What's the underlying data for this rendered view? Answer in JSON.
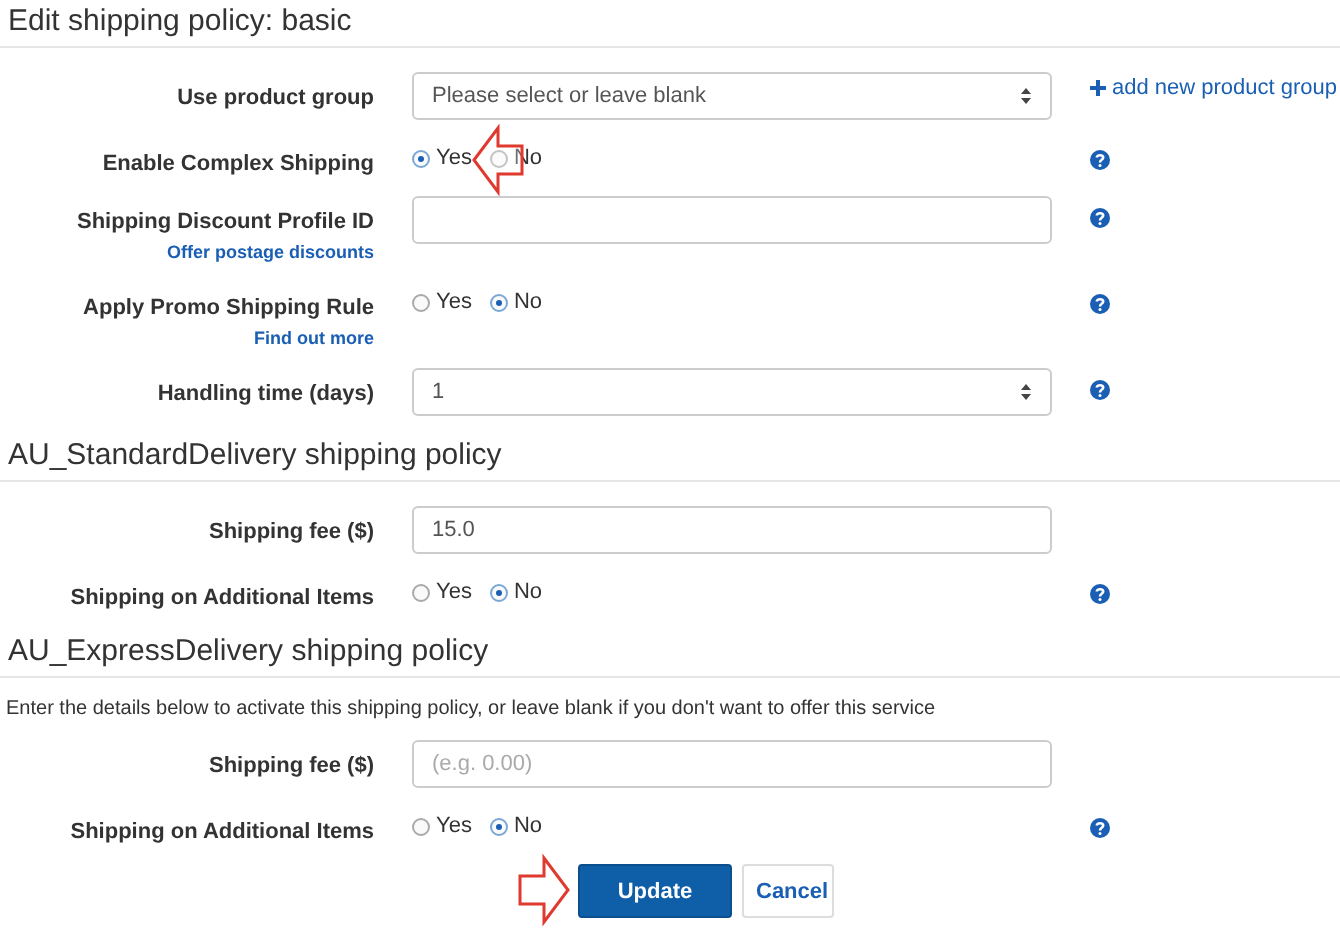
{
  "sections": [
    {
      "title": "Edit shipping policy: basic",
      "rows": [
        {
          "kind": "select",
          "label": "Use product group",
          "value": "Please select or leave blank",
          "side_link": "add new product group"
        },
        {
          "kind": "radio",
          "label": "Enable Complex Shipping",
          "options": [
            {
              "label": "Yes",
              "selected": true
            },
            {
              "label": "No",
              "selected": false
            }
          ],
          "help": true,
          "arrow": true
        },
        {
          "kind": "text",
          "label": "Shipping Discount Profile ID",
          "link": "Offer postage discounts",
          "help": true
        },
        {
          "kind": "radio",
          "label": "Apply Promo Shipping Rule",
          "link": "Find out more",
          "options": [
            {
              "label": "Yes",
              "selected": false
            },
            {
              "label": "No",
              "selected": true
            }
          ],
          "help": true
        },
        {
          "kind": "select",
          "label": "Handling time (days)",
          "value": "1",
          "help": true
        }
      ]
    },
    {
      "title": "AU_StandardDelivery shipping policy",
      "rows": [
        {
          "kind": "text",
          "label": "Shipping fee ($)",
          "value": "15.0"
        },
        {
          "kind": "radio",
          "label": "Shipping on Additional Items",
          "options": [
            {
              "label": "Yes",
              "selected": false
            },
            {
              "label": "No",
              "selected": true
            }
          ],
          "help": true
        }
      ]
    },
    {
      "title": "AU_ExpressDelivery shipping policy",
      "note": "Enter the details below to activate this shipping policy, or leave blank if you don't want to offer this service",
      "rows": [
        {
          "kind": "text",
          "label": "Shipping fee ($)",
          "placeholder": "(e.g. 0.00)"
        },
        {
          "kind": "radio",
          "label": "Shipping on Additional Items",
          "options": [
            {
              "label": "Yes",
              "selected": false
            },
            {
              "label": "No",
              "selected": true
            }
          ],
          "help": true
        }
      ]
    }
  ],
  "buttons": [
    {
      "label": "Update",
      "kind": "primary"
    },
    {
      "label": "Cancel",
      "kind": "secondary"
    }
  ],
  "buttons_arrow": true
}
